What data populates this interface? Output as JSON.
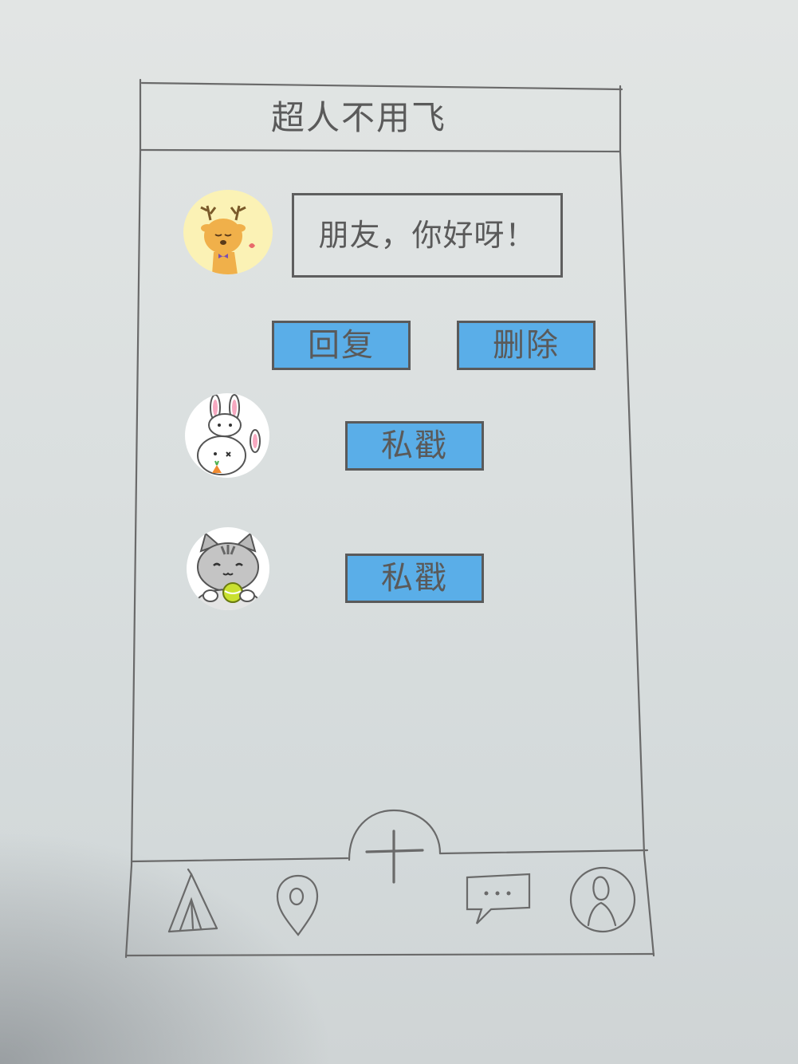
{
  "header": {
    "title": "超人不用飞"
  },
  "message": {
    "text": "朋友，你好呀！",
    "avatar_icon": "deer-avatar-icon"
  },
  "actions": {
    "reply_label": "回复",
    "delete_label": "删除"
  },
  "contacts": [
    {
      "avatar_icon": "rabbit-avatar-icon",
      "button_label": "私戳"
    },
    {
      "avatar_icon": "cat-avatar-icon",
      "button_label": "私戳"
    }
  ],
  "tabbar": {
    "items": [
      "tent-icon",
      "location-pin-icon",
      "add-icon",
      "chat-bubble-icon",
      "profile-icon"
    ]
  },
  "colors": {
    "button_fill": "#5aaee8",
    "line": "#5a5a5a",
    "paper": "#dfe3e3"
  }
}
